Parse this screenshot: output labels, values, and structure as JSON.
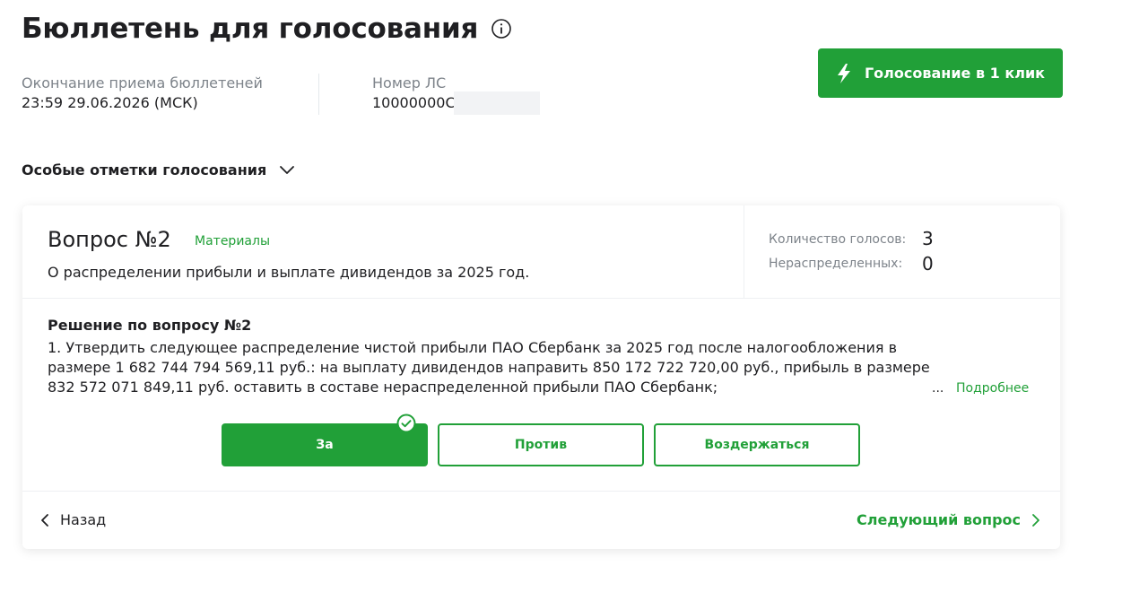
{
  "header": {
    "title": "Бюллетень для голосования",
    "deadline_label": "Окончание приема бюллетеней",
    "deadline_value": "23:59 29.06.2026 (МСК)",
    "account_label": "Номер ЛС",
    "account_value": "10000000С",
    "quick_vote_label": "Голосование в 1 клик"
  },
  "special_marks": {
    "label": "Особые отметки голосования"
  },
  "question": {
    "title": "Вопрос №2",
    "materials_label": "Материалы",
    "subtitle": "О распределении прибыли и выплате дивидендов за 2025 год.",
    "votes_count_label": "Количество голосов:",
    "votes_count_value": "3",
    "unallocated_label": "Нераспределенных:",
    "unallocated_value": "0",
    "decision_title": "Решение по вопросу №2",
    "decision_text": "1. Утвердить следующее распределение чистой прибыли ПАО Сбербанк за 2025 год после налогообложения в размере 1 682 744 794 569,11 руб.: на выплату дивидендов направить 850 172 722 720,00 руб., прибыль в размере 832 572 071 849,11 руб. оставить в составе нераспределенной прибыли ПАО Сбербанк;",
    "ellipsis": "...",
    "more_label": "Подробнее",
    "options": {
      "for": "За",
      "against": "Против",
      "abstain": "Воздержаться"
    },
    "selected_option": "for"
  },
  "footer": {
    "back_label": "Назад",
    "next_label": "Следующий вопрос"
  },
  "colors": {
    "accent": "#21a038",
    "text": "#1f1f22",
    "muted": "#7d838a"
  },
  "icons": [
    "info-icon",
    "lightning-icon",
    "chevron-down-icon",
    "check-circle-icon",
    "chevron-left-icon",
    "chevron-right-icon"
  ]
}
